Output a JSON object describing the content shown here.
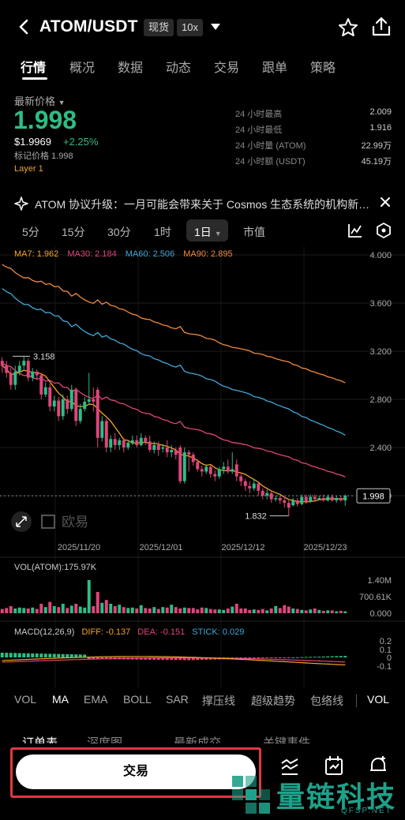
{
  "header": {
    "pair": "ATOM/USDT",
    "tag_spot": "现货",
    "tag_leverage": "10x"
  },
  "tabs": [
    "行情",
    "概况",
    "数据",
    "动态",
    "交易",
    "跟单",
    "策略"
  ],
  "price": {
    "label": "最新价格",
    "last": "1.998",
    "usd": "$1.9969",
    "change": "+2.25%",
    "mark": "标记价格 1.998",
    "category": "Layer 1"
  },
  "stats": [
    {
      "k": "24 小时最高",
      "v": "2.009"
    },
    {
      "k": "24 小时最低",
      "v": "1.916"
    },
    {
      "k": "24 小时量 (ATOM)",
      "v": "22.99万"
    },
    {
      "k": "24 小时额 (USDT)",
      "v": "45.19万"
    }
  ],
  "news": {
    "text": "ATOM 协议升级：一月可能会带来关于 Cosmos 生态系统的机构新…"
  },
  "timeframes": {
    "items": [
      "5分",
      "15分",
      "30分",
      "1时",
      "1日",
      "市值"
    ],
    "selected": "1日"
  },
  "ma": {
    "ma7": "MA7: 1.962",
    "ma30": "MA30: 2.184",
    "ma60": "MA60: 2.506",
    "ma90": "MA90: 2.895"
  },
  "colors": {
    "up": "#2ebd85",
    "down": "#e0457b",
    "ma7": "#f5a623",
    "ma30": "#e0457b",
    "ma60": "#3fa9d8",
    "ma90": "#f08a3c",
    "accent_red": "#e0393e"
  },
  "chart_data": [
    {
      "type": "candlestick",
      "y_ticks": [
        "4.000",
        "3.600",
        "3.200",
        "2.800",
        "2.400",
        "2.000"
      ],
      "ylim": [
        1.8,
        4.0
      ],
      "x_ticks": [
        "2025/11/20",
        "2025/12/01",
        "2025/12/12",
        "2025/12/23"
      ],
      "current_price_label": "1.998",
      "high_label": "3.158",
      "low_label": "1.832",
      "watermark": "欧易",
      "candles": [
        [
          3.12,
          3.08,
          3.15,
          3.02
        ],
        [
          3.08,
          3.02,
          3.12,
          2.98
        ],
        [
          3.02,
          2.92,
          3.06,
          2.88
        ],
        [
          2.92,
          3.03,
          3.08,
          2.88
        ],
        [
          3.03,
          3.08,
          3.12,
          3.0
        ],
        [
          3.08,
          3.12,
          3.16,
          3.05
        ],
        [
          3.12,
          2.98,
          3.14,
          2.95
        ],
        [
          2.98,
          3.03,
          3.06,
          2.95
        ],
        [
          3.03,
          3.0,
          3.05,
          2.96
        ],
        [
          3.0,
          2.84,
          3.02,
          2.8
        ],
        [
          2.84,
          2.9,
          2.94,
          2.82
        ],
        [
          2.9,
          2.74,
          2.93,
          2.7
        ],
        [
          2.74,
          2.79,
          2.83,
          2.7
        ],
        [
          2.79,
          2.66,
          2.82,
          2.62
        ],
        [
          2.66,
          2.8,
          2.84,
          2.63
        ],
        [
          2.8,
          2.72,
          2.83,
          2.68
        ],
        [
          2.72,
          2.88,
          2.92,
          2.7
        ],
        [
          2.88,
          2.62,
          2.9,
          2.58
        ],
        [
          2.62,
          2.72,
          2.76,
          2.6
        ],
        [
          2.72,
          2.78,
          2.82,
          2.7
        ],
        [
          2.78,
          2.8,
          3.02,
          2.76
        ],
        [
          2.8,
          2.78,
          2.9,
          2.7
        ],
        [
          2.88,
          2.48,
          2.9,
          2.4
        ],
        [
          2.48,
          2.62,
          2.66,
          2.45
        ],
        [
          2.62,
          2.4,
          2.64,
          2.36
        ],
        [
          2.4,
          2.47,
          2.5,
          2.36
        ],
        [
          2.47,
          2.42,
          2.52,
          2.38
        ],
        [
          2.42,
          2.46,
          2.48,
          2.38
        ],
        [
          2.46,
          2.4,
          2.48,
          2.36
        ],
        [
          2.4,
          2.44,
          2.46,
          2.38
        ],
        [
          2.44,
          2.46,
          2.5,
          2.42
        ],
        [
          2.46,
          2.42,
          2.5,
          2.4
        ],
        [
          2.42,
          2.48,
          2.52,
          2.41
        ],
        [
          2.48,
          2.45,
          2.5,
          2.42
        ],
        [
          2.45,
          2.38,
          2.5,
          2.36
        ],
        [
          2.38,
          2.42,
          2.45,
          2.35
        ],
        [
          2.42,
          2.38,
          2.45,
          2.33
        ],
        [
          2.4,
          2.4,
          2.43,
          2.36
        ],
        [
          2.4,
          2.36,
          2.46,
          2.32
        ],
        [
          2.36,
          2.38,
          2.42,
          2.32
        ],
        [
          2.38,
          2.34,
          2.4,
          2.3
        ],
        [
          2.4,
          2.12,
          2.42,
          2.1
        ],
        [
          2.12,
          2.36,
          2.4,
          2.1
        ],
        [
          2.36,
          2.34,
          2.38,
          2.2
        ],
        [
          2.34,
          2.28,
          2.36,
          2.25
        ],
        [
          2.28,
          2.22,
          2.3,
          2.2
        ],
        [
          2.22,
          2.2,
          2.25,
          2.16
        ],
        [
          2.2,
          2.24,
          2.26,
          2.18
        ],
        [
          2.24,
          2.18,
          2.26,
          2.15
        ],
        [
          2.18,
          2.16,
          2.21,
          2.12
        ],
        [
          2.16,
          2.22,
          2.24,
          2.14
        ],
        [
          2.22,
          2.24,
          2.28,
          2.18
        ],
        [
          2.24,
          2.2,
          2.3,
          2.18
        ],
        [
          2.2,
          2.22,
          2.36,
          2.18
        ],
        [
          2.26,
          2.16,
          2.3,
          2.12
        ],
        [
          2.16,
          2.12,
          2.18,
          2.08
        ],
        [
          2.12,
          2.08,
          2.14,
          2.04
        ],
        [
          2.08,
          2.06,
          2.12,
          2.02
        ],
        [
          2.06,
          2.1,
          2.14,
          2.04
        ],
        [
          2.1,
          2.04,
          2.12,
          2.0
        ],
        [
          2.04,
          2.0,
          2.06,
          1.97
        ],
        [
          2.0,
          2.02,
          2.05,
          1.97
        ],
        [
          2.02,
          1.97,
          2.04,
          1.94
        ],
        [
          1.97,
          1.98,
          2.0,
          1.95
        ],
        [
          1.98,
          1.96,
          2.0,
          1.93
        ],
        [
          1.96,
          1.94,
          1.99,
          1.9
        ],
        [
          1.94,
          1.9,
          1.96,
          1.832
        ],
        [
          1.92,
          1.96,
          1.98,
          1.91
        ],
        [
          1.96,
          1.93,
          1.98,
          1.91
        ],
        [
          1.93,
          1.99,
          2.01,
          1.92
        ],
        [
          1.99,
          1.95,
          2.01,
          1.93
        ],
        [
          1.95,
          1.99,
          2.01,
          1.94
        ],
        [
          1.99,
          1.97,
          2.01,
          1.95
        ],
        [
          1.97,
          1.98,
          2.0,
          1.96
        ],
        [
          1.98,
          1.96,
          2.01,
          1.95
        ],
        [
          1.96,
          1.99,
          2.01,
          1.95
        ],
        [
          1.99,
          1.96,
          2.01,
          1.95
        ],
        [
          1.96,
          1.98,
          2.0,
          1.94
        ],
        [
          1.98,
          1.96,
          2.0,
          1.95
        ],
        [
          1.96,
          1.998,
          2.009,
          1.916
        ]
      ]
    },
    {
      "type": "bar",
      "title": "VOL(ATOM):175.97K",
      "y_ticks": [
        "1.40M",
        "700.61K",
        "0.000"
      ],
      "ylim": [
        0,
        1.5
      ],
      "values_millions": [
        0.18,
        0.22,
        0.3,
        0.2,
        0.24,
        0.22,
        0.2,
        0.24,
        0.18,
        0.4,
        0.26,
        0.48,
        0.3,
        0.26,
        0.4,
        0.22,
        0.32,
        0.4,
        0.28,
        0.24,
        1.4,
        0.3,
        0.9,
        0.44,
        0.56,
        0.4,
        0.3,
        0.36,
        0.26,
        0.22,
        0.24,
        0.2,
        0.34,
        0.22,
        0.2,
        0.26,
        0.18,
        0.26,
        0.24,
        0.36,
        0.26,
        0.2,
        0.24,
        0.22,
        0.22,
        0.16,
        0.24,
        0.22,
        0.18,
        0.16,
        0.16,
        0.14,
        0.2,
        0.28,
        0.4,
        0.2,
        0.2,
        0.14,
        0.16,
        0.14,
        0.18,
        0.12,
        0.2,
        0.3,
        0.22,
        0.34,
        0.28,
        0.2,
        0.18,
        0.14,
        0.12,
        0.16,
        0.2,
        0.14,
        0.1,
        0.12,
        0.12,
        0.08,
        0.1,
        0.08
      ]
    },
    {
      "type": "macd",
      "y_ticks": [
        "0.2",
        "0.1",
        "0",
        "-0.1"
      ],
      "ylim": [
        -0.15,
        0.25
      ]
    }
  ],
  "macd": {
    "title": "MACD(12,26,9)",
    "diff": "DIFF: -0.137",
    "dea": "DEA: -0.151",
    "stick": "STICK: 0.029"
  },
  "indicators": [
    "VOL",
    "MA",
    "EMA",
    "BOLL",
    "SAR",
    "撑压线",
    "超级趋势",
    "包络线",
    "VOL"
  ],
  "bottom_tabs": [
    "订单表",
    "深度图",
    "最新成交",
    "关键事件"
  ],
  "trade_button": "交易",
  "watermark": {
    "title": "量链科技",
    "site": "QFSP.NET"
  }
}
